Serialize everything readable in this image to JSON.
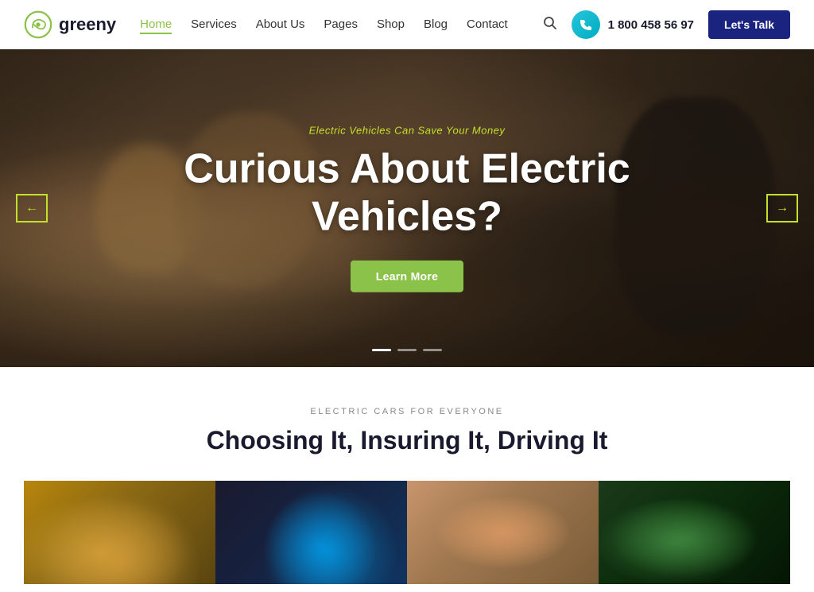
{
  "brand": {
    "logo_text": "greeny"
  },
  "navbar": {
    "links": [
      {
        "label": "Home",
        "active": true
      },
      {
        "label": "Services",
        "active": false
      },
      {
        "label": "About Us",
        "active": false
      },
      {
        "label": "Pages",
        "active": false
      },
      {
        "label": "Shop",
        "active": false
      },
      {
        "label": "Blog",
        "active": false
      },
      {
        "label": "Contact",
        "active": false
      }
    ],
    "phone": "1 800 458 56 97",
    "cta_label": "Let's Talk"
  },
  "hero": {
    "tagline": "Electric Vehicles Can Save Your Money",
    "title": "Curious About Electric Vehicles?",
    "cta_label": "Learn More",
    "arrow_left": "←",
    "arrow_right": "→"
  },
  "section": {
    "label": "ELECTRIC CARS FOR EVERYONE",
    "title": "Choosing It, Insuring It, Driving It"
  },
  "cards": [
    {
      "alt": "Car dashboard"
    },
    {
      "alt": "EV charging"
    },
    {
      "alt": "People in car"
    },
    {
      "alt": "Green plant"
    }
  ]
}
